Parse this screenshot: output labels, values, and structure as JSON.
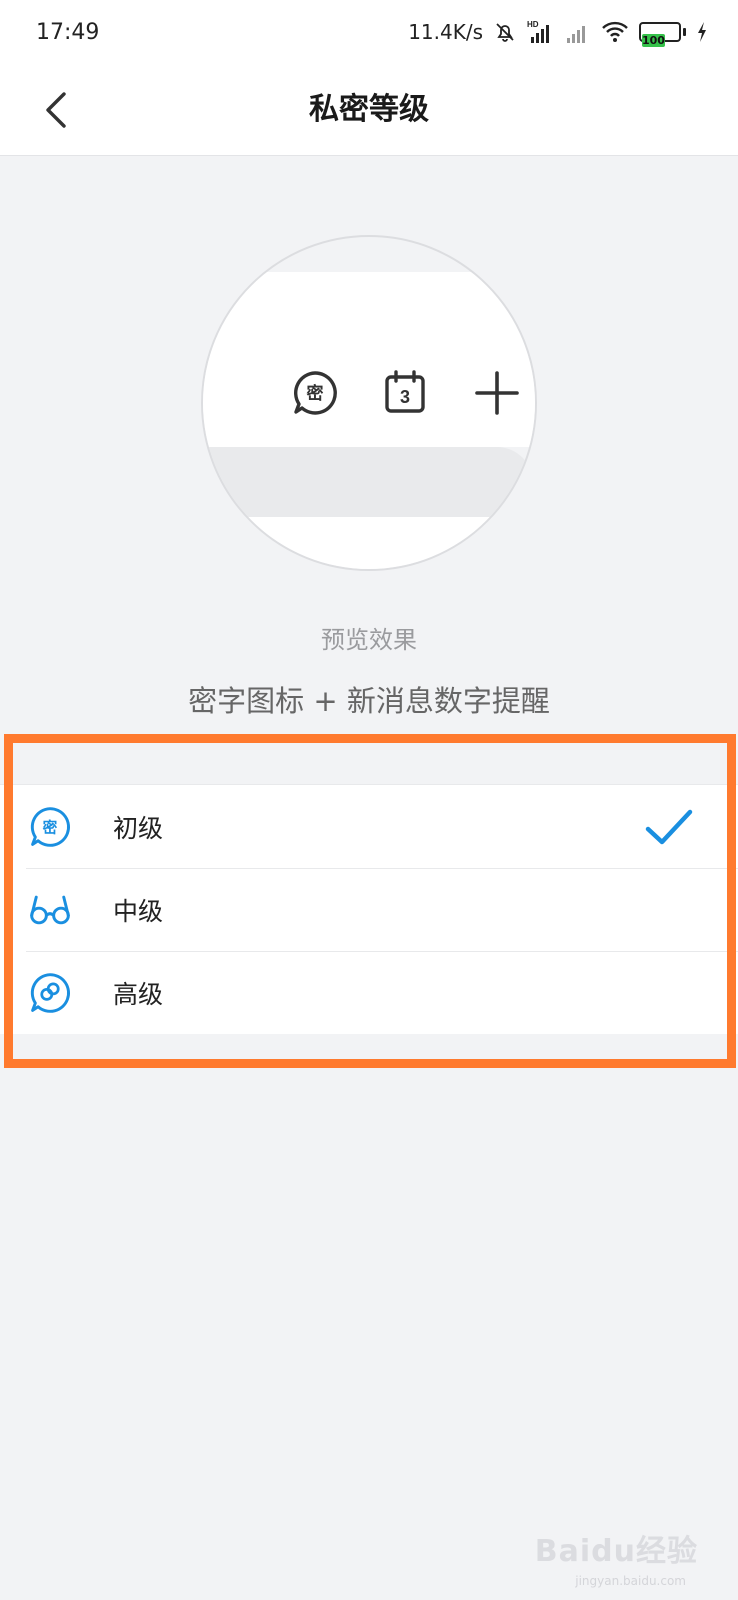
{
  "status_bar": {
    "time": "17:49",
    "network_speed": "11.4K/s",
    "battery_level": "100",
    "icons": [
      "mute-bell-icon",
      "hd-signal-icon",
      "signal-icon",
      "wifi-icon",
      "battery-icon",
      "charging-icon"
    ],
    "hd_label": "HD"
  },
  "nav": {
    "title": "私密等级"
  },
  "preview": {
    "label": "预览效果",
    "description": "密字图标 + 新消息数字提醒",
    "icons": [
      "mi-chat-icon",
      "calendar-icon",
      "plus-icon"
    ],
    "mi_char": "密",
    "calendar_number": "3"
  },
  "levels": {
    "items": [
      {
        "label": "初级",
        "icon": "mi-chat-icon",
        "selected": true
      },
      {
        "label": "中级",
        "icon": "glasses-icon",
        "selected": false
      },
      {
        "label": "高级",
        "icon": "link-chat-icon",
        "selected": false
      }
    ],
    "icon_char_first": "密"
  },
  "colors": {
    "accent": "#1a8fe0",
    "highlight": "#ff7a2e",
    "background": "#f2f3f5"
  },
  "watermark": {
    "text": "Baidu经验",
    "sub": "jingyan.baidu.com"
  }
}
